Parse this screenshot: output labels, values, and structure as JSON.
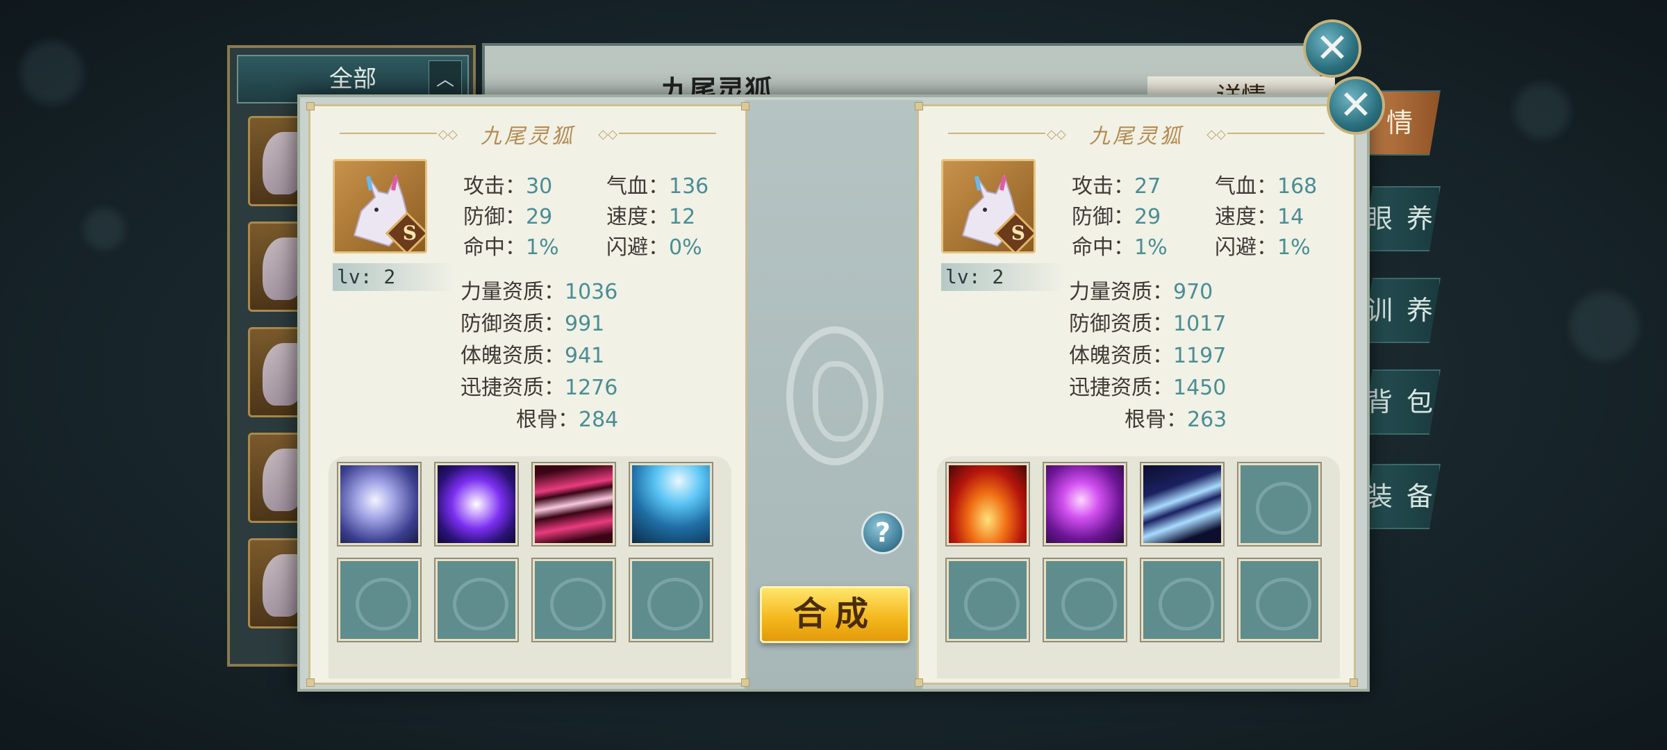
{
  "background_window": {
    "list_header": "全部",
    "pet_name": "九尾灵狐",
    "detail_title": "详情",
    "tabs": [
      "情",
      "眼 养",
      "训 养",
      "背 包",
      "装 备"
    ]
  },
  "compose_button": "合成",
  "help_icon": "?",
  "left_pet": {
    "name": "九尾灵狐",
    "rank": "S",
    "level": "lv: 2",
    "stats": [
      {
        "label": "攻击：",
        "value": "30"
      },
      {
        "label": "气血：",
        "value": "136"
      },
      {
        "label": "防御：",
        "value": "29"
      },
      {
        "label": "速度：",
        "value": "12"
      },
      {
        "label": "命中：",
        "value": "1%"
      },
      {
        "label": "闪避：",
        "value": "0%"
      }
    ],
    "aptitudes": [
      {
        "label": "力量资质：",
        "value": "1036"
      },
      {
        "label": "防御资质：",
        "value": "991"
      },
      {
        "label": "体魄资质：",
        "value": "941"
      },
      {
        "label": "迅捷资质：",
        "value": "1276"
      },
      {
        "label": "根骨：",
        "value": "284"
      }
    ],
    "skills": [
      "white-swirl-skill-icon",
      "purple-orb-skill-icon",
      "pink-streak-skill-icon",
      "lightning-skill-icon",
      "empty",
      "empty",
      "empty",
      "empty"
    ]
  },
  "right_pet": {
    "name": "九尾灵狐",
    "rank": "S",
    "level": "lv: 2",
    "stats": [
      {
        "label": "攻击：",
        "value": "27"
      },
      {
        "label": "气血：",
        "value": "168"
      },
      {
        "label": "防御：",
        "value": "29"
      },
      {
        "label": "速度：",
        "value": "14"
      },
      {
        "label": "命中：",
        "value": "1%"
      },
      {
        "label": "闪避：",
        "value": "1%"
      }
    ],
    "aptitudes": [
      {
        "label": "力量资质：",
        "value": "970"
      },
      {
        "label": "防御资质：",
        "value": "1017"
      },
      {
        "label": "体魄资质：",
        "value": "1197"
      },
      {
        "label": "迅捷资质：",
        "value": "1450"
      },
      {
        "label": "根骨：",
        "value": "263"
      }
    ],
    "skills": [
      "fire-skill-icon",
      "purple-slash-skill-icon",
      "claw-skill-icon",
      "empty",
      "empty",
      "empty",
      "empty",
      "empty"
    ]
  }
}
